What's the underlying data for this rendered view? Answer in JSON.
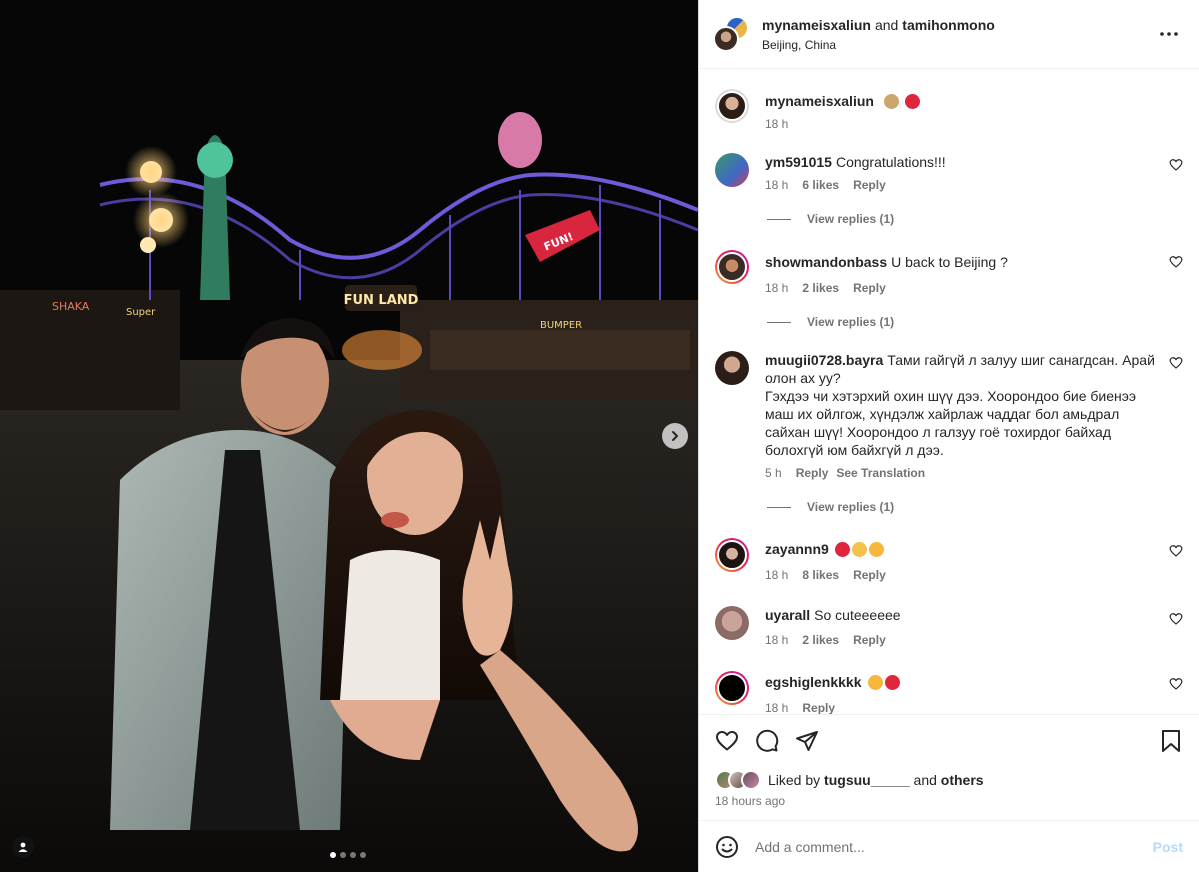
{
  "post": {
    "author": "mynameisxaliun",
    "and_label": "and",
    "coauthor": "tamihonmono",
    "location": "Beijing, China"
  },
  "caption": {
    "user": "mynameisxaliun",
    "time": "18 h"
  },
  "comments": [
    {
      "user": "ym591015",
      "text": "Congratulations!!!",
      "time": "18 h",
      "likes": "6 likes",
      "reply": "Reply",
      "view_replies": "View replies (1)"
    },
    {
      "user": "showmandonbass",
      "text": "U back to Beijing ?",
      "time": "18 h",
      "likes": "2 likes",
      "reply": "Reply",
      "view_replies": "View replies (1)"
    },
    {
      "user": "muugii0728.bayra",
      "text": "Тами гайгүй л залуу шиг санагдсан. Арай олон ах уу?",
      "text2": "Гэхдээ чи хэтэрхий охин шүү дээ. Хоорондоо бие биенээ маш их ойлгож, хүндэлж хайрлаж чаддаг бол амьдрал сайхан шүү! Хоорондоо л галзуу гоё тохирдог байхад болохгүй юм байхгүй л дээ.",
      "time": "5 h",
      "reply": "Reply",
      "translate": "See Translation",
      "view_replies": "View replies (1)"
    },
    {
      "user": "zayannn9",
      "text": "",
      "time": "18 h",
      "likes": "8 likes",
      "reply": "Reply"
    },
    {
      "user": "uyarall",
      "text": "So cuteeeeee",
      "time": "18 h",
      "likes": "2 likes",
      "reply": "Reply"
    },
    {
      "user": "egshiglenkkkk",
      "text": "",
      "time": "18 h",
      "reply": "Reply"
    }
  ],
  "likes": {
    "prefix": "Liked by",
    "user": "tugsuu_____",
    "and": "and",
    "others": "others"
  },
  "time_ago": "18 hours ago",
  "comment_box": {
    "placeholder": "Add a comment...",
    "post_label": "Post"
  },
  "carousel": {
    "count": 4,
    "active": 1
  },
  "colors": {
    "accent_disabled": "#b3dbff",
    "ring_start": "#f7a22a",
    "ring_end": "#c417a8",
    "heart_red": "#ff3040"
  }
}
